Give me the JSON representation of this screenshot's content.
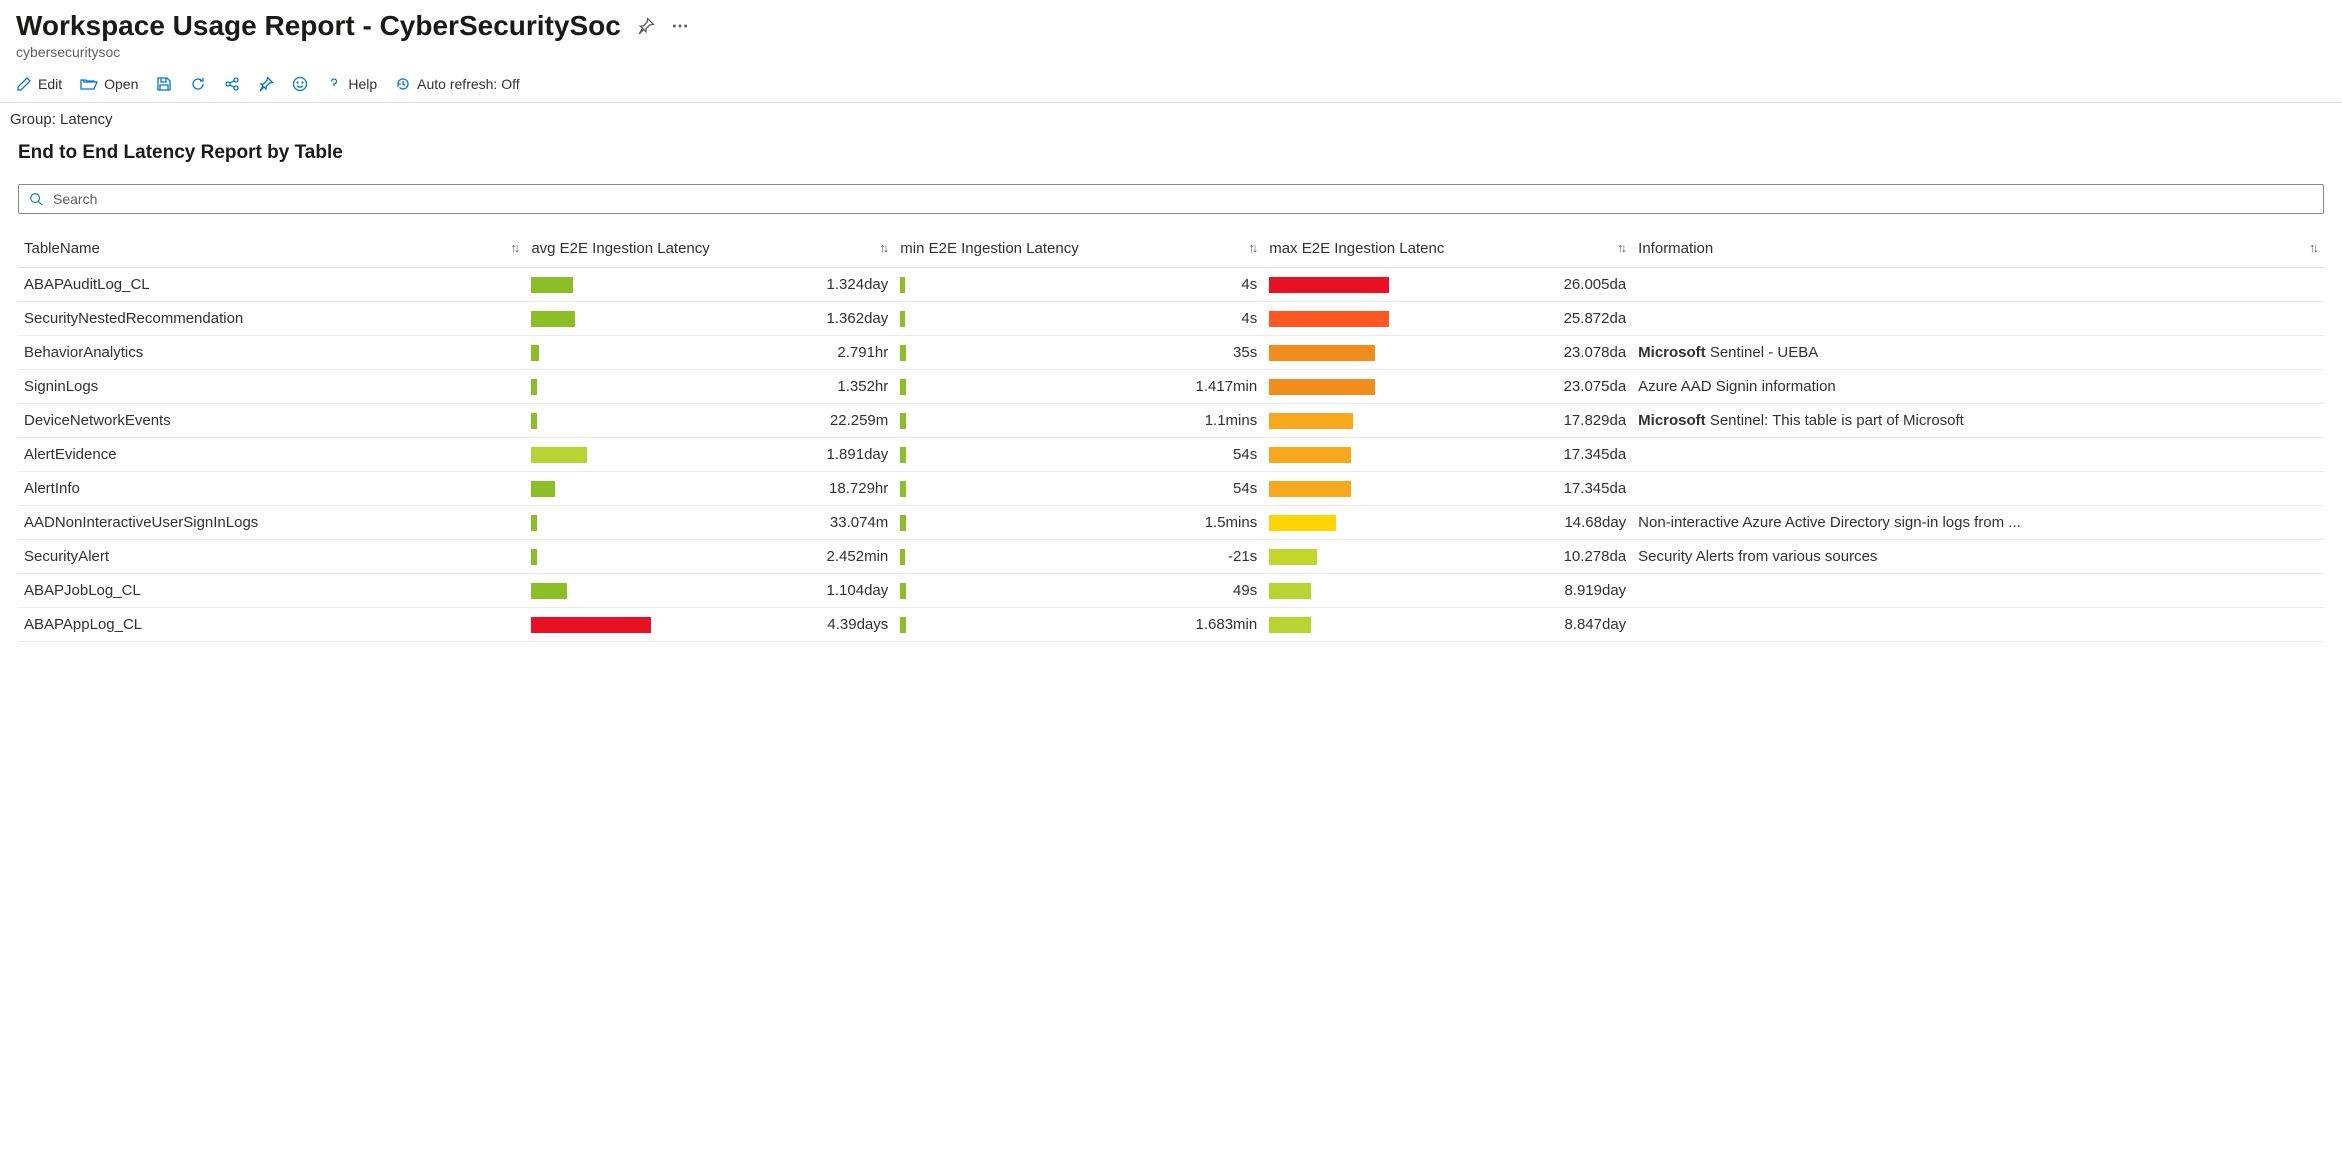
{
  "header": {
    "title": "Workspace Usage Report - CyberSecuritySoc",
    "subtitle": "cybersecuritysoc"
  },
  "toolbar": {
    "edit": "Edit",
    "open": "Open",
    "help": "Help",
    "autorefresh": "Auto refresh: Off"
  },
  "group_label": "Group: Latency",
  "report_title": "End to End Latency Report by Table",
  "search_placeholder": "Search",
  "columns": {
    "tablename": "TableName",
    "avg": "avg E2E Ingestion Latency",
    "min": "min E2E Ingestion Latency",
    "max": "max E2E Ingestion Latenc",
    "info": "Information"
  },
  "rows": [
    {
      "name": "ABAPAuditLog_CL",
      "avg_text": "1.324day",
      "avg_pct": 35,
      "avg_color": "#8cbf26",
      "min_text": "4s",
      "min_pct": 4,
      "min_color": "#8cbf26",
      "max_text": "26.005da",
      "max_pct": 100,
      "max_color": "#e81123",
      "info": ""
    },
    {
      "name": "SecurityNestedRecommendation",
      "avg_text": "1.362day",
      "avg_pct": 36,
      "avg_color": "#8cbf26",
      "min_text": "4s",
      "min_pct": 4,
      "min_color": "#8cbf26",
      "max_text": "25.872da",
      "max_pct": 100,
      "max_color": "#ff5722",
      "info": ""
    },
    {
      "name": "BehaviorAnalytics",
      "avg_text": "2.791hr",
      "avg_pct": 6,
      "avg_color": "#8cbf26",
      "min_text": "35s",
      "min_pct": 5,
      "min_color": "#8cbf26",
      "max_text": "23.078da",
      "max_pct": 88,
      "max_color": "#f28c1c",
      "info_bold": "Microsoft",
      "info_rest": " Sentinel - UEBA"
    },
    {
      "name": "SigninLogs",
      "avg_text": "1.352hr",
      "avg_pct": 5,
      "avg_color": "#8cbf26",
      "min_text": "1.417min",
      "min_pct": 5,
      "min_color": "#8cbf26",
      "max_text": "23.075da",
      "max_pct": 88,
      "max_color": "#f28c1c",
      "info": "Azure AAD Signin information"
    },
    {
      "name": "DeviceNetworkEvents",
      "avg_text": "22.259m",
      "avg_pct": 5,
      "avg_color": "#8cbf26",
      "min_text": "1.1mins",
      "min_pct": 5,
      "min_color": "#8cbf26",
      "max_text": "17.829da",
      "max_pct": 70,
      "max_color": "#f7a81b",
      "info_bold": "Microsoft",
      "info_rest": " Sentinel: This table is part of Microsoft"
    },
    {
      "name": "AlertEvidence",
      "avg_text": "1.891day",
      "avg_pct": 46,
      "avg_color": "#b8d432",
      "min_text": "54s",
      "min_pct": 5,
      "min_color": "#8cbf26",
      "max_text": "17.345da",
      "max_pct": 68,
      "max_color": "#f7a81b",
      "info": ""
    },
    {
      "name": "AlertInfo",
      "avg_text": "18.729hr",
      "avg_pct": 20,
      "avg_color": "#8cbf26",
      "min_text": "54s",
      "min_pct": 5,
      "min_color": "#8cbf26",
      "max_text": "17.345da",
      "max_pct": 68,
      "max_color": "#f7a81b",
      "info": ""
    },
    {
      "name": "AADNonInteractiveUserSignInLogs",
      "avg_text": "33.074m",
      "avg_pct": 5,
      "avg_color": "#8cbf26",
      "min_text": "1.5mins",
      "min_pct": 5,
      "min_color": "#8cbf26",
      "max_text": "14.68day",
      "max_pct": 56,
      "max_color": "#ffd400",
      "info": "Non-interactive Azure Active Directory sign-in logs from ..."
    },
    {
      "name": "SecurityAlert",
      "avg_text": "2.452min",
      "avg_pct": 5,
      "avg_color": "#8cbf26",
      "min_text": "-21s",
      "min_pct": 4,
      "min_color": "#8cbf26",
      "max_text": "10.278da",
      "max_pct": 40,
      "max_color": "#c1d72e",
      "info": "Security Alerts from various sources"
    },
    {
      "name": "ABAPJobLog_CL",
      "avg_text": "1.104day",
      "avg_pct": 30,
      "avg_color": "#8cbf26",
      "min_text": "49s",
      "min_pct": 5,
      "min_color": "#8cbf26",
      "max_text": "8.919day",
      "max_pct": 35,
      "max_color": "#b8d432",
      "info": ""
    },
    {
      "name": "ABAPAppLog_CL",
      "avg_text": "4.39days",
      "avg_pct": 100,
      "avg_color": "#e81123",
      "min_text": "1.683min",
      "min_pct": 5,
      "min_color": "#8cbf26",
      "max_text": "8.847day",
      "max_pct": 35,
      "max_color": "#b8d432",
      "info": ""
    }
  ]
}
